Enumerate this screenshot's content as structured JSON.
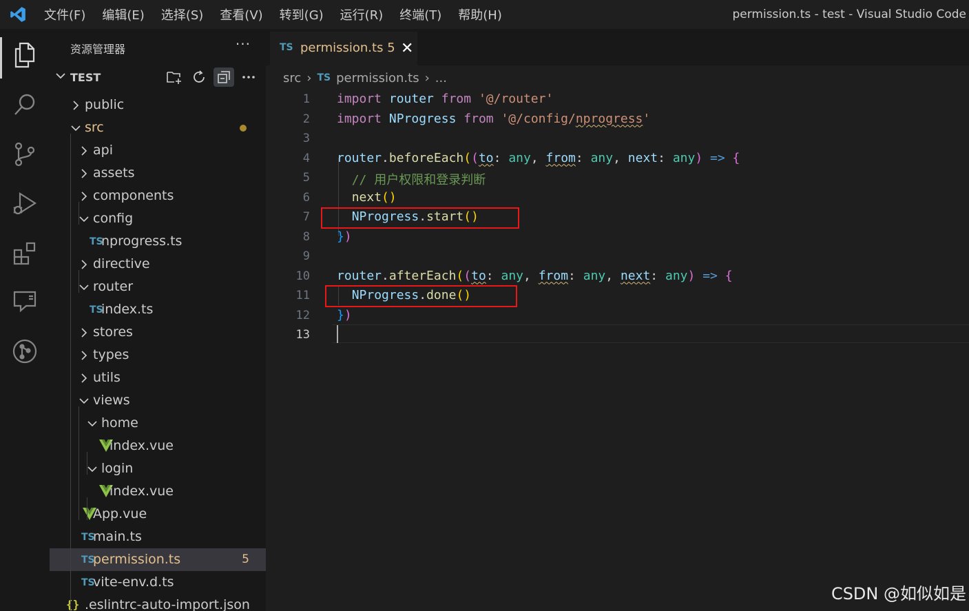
{
  "window": {
    "title": "permission.ts - test - Visual Studio Code",
    "menu": [
      "文件(F)",
      "编辑(E)",
      "选择(S)",
      "查看(V)",
      "转到(G)",
      "运行(R)",
      "终端(T)",
      "帮助(H)"
    ]
  },
  "activity_bar": {
    "icons": [
      "explorer-icon",
      "search-icon",
      "source-control-icon",
      "run-debug-icon",
      "extensions-icon",
      "remote-explorer-icon",
      "git-graph-icon"
    ],
    "active": "explorer-icon"
  },
  "sidebar": {
    "header": "资源管理器",
    "more": "···",
    "section_title": "TEST",
    "tree": [
      {
        "label": "public",
        "type": "folder",
        "open": false
      },
      {
        "label": "src",
        "type": "folder",
        "open": true,
        "modified": true
      },
      {
        "label": "api",
        "type": "folder",
        "open": false
      },
      {
        "label": "assets",
        "type": "folder",
        "open": false
      },
      {
        "label": "components",
        "type": "folder",
        "open": false
      },
      {
        "label": "config",
        "type": "folder",
        "open": true
      },
      {
        "label": "nprogress.ts",
        "type": "ts"
      },
      {
        "label": "directive",
        "type": "folder",
        "open": false
      },
      {
        "label": "router",
        "type": "folder",
        "open": true
      },
      {
        "label": "index.ts",
        "type": "ts"
      },
      {
        "label": "stores",
        "type": "folder",
        "open": false
      },
      {
        "label": "types",
        "type": "folder",
        "open": false
      },
      {
        "label": "utils",
        "type": "folder",
        "open": false
      },
      {
        "label": "views",
        "type": "folder",
        "open": true
      },
      {
        "label": "home",
        "type": "folder",
        "open": true
      },
      {
        "label": "index.vue",
        "type": "vue"
      },
      {
        "label": "login",
        "type": "folder",
        "open": true
      },
      {
        "label": "index.vue",
        "type": "vue"
      },
      {
        "label": "App.vue",
        "type": "vue"
      },
      {
        "label": "main.ts",
        "type": "ts"
      },
      {
        "label": "permission.ts",
        "type": "ts",
        "selected": true,
        "problems": "5"
      },
      {
        "label": "vite-env.d.ts",
        "type": "ts"
      },
      {
        "label": ".eslintrc-auto-import.json",
        "type": "json"
      }
    ]
  },
  "tab": {
    "icon": "TS",
    "label": "permission.ts",
    "problems": "5"
  },
  "breadcrumb": {
    "folder": "src",
    "icon": "TS",
    "file": "permission.ts",
    "tail": "..."
  },
  "editor": {
    "line_numbers": [
      "1",
      "2",
      "3",
      "4",
      "5",
      "6",
      "7",
      "8",
      "9",
      "10",
      "11",
      "12",
      "13"
    ],
    "current_line": "13",
    "lines": [
      "import router from '@/router'",
      "import NProgress from '@/config/nprogress'",
      "",
      "router.beforeEach((to: any, from: any, next: any) => {",
      "  // 用户权限和登录判断",
      "  next()",
      "  NProgress.start()",
      "})",
      "",
      "router.afterEach((to: any, from: any, next: any) => {",
      "  NProgress.done()",
      "})",
      ""
    ]
  },
  "watermark": "CSDN @如似如是",
  "colors": {
    "highlight_box": "#e81818",
    "modified": "#e2c08d",
    "ts_icon": "#519aba",
    "vue_icon": "#8dc149"
  }
}
